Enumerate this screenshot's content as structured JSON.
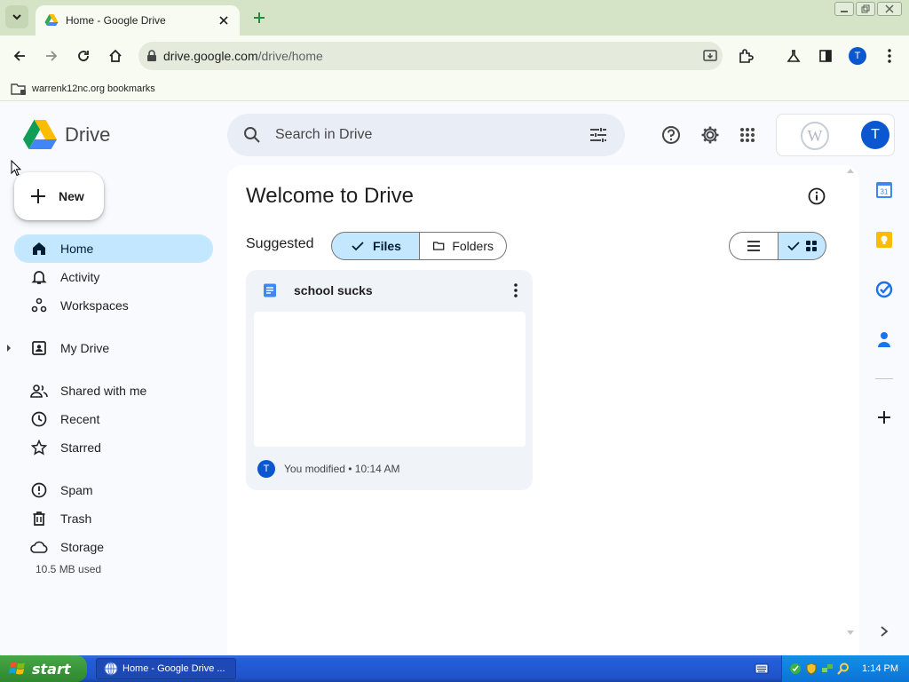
{
  "browser": {
    "tab_title": "Home - Google Drive",
    "url_domain": "drive.google.com",
    "url_path": "/drive/home",
    "profile_initial": "T",
    "bookmark_label": "warrenk12nc.org bookmarks",
    "theme_color": "#d5e3c7"
  },
  "drive": {
    "logo_text": "Drive",
    "search_placeholder": "Search in Drive",
    "new_label": "New",
    "account_initial": "T",
    "workspace_logo_letter": "W",
    "nav": [
      {
        "label": "Home",
        "icon": "home-icon",
        "active": true
      },
      {
        "label": "Activity",
        "icon": "bell-icon"
      },
      {
        "label": "Workspaces",
        "icon": "workspaces-icon"
      },
      {
        "label": "My Drive",
        "icon": "my-drive-icon"
      },
      {
        "label": "Shared with me",
        "icon": "people-icon"
      },
      {
        "label": "Recent",
        "icon": "clock-icon"
      },
      {
        "label": "Starred",
        "icon": "star-icon"
      },
      {
        "label": "Spam",
        "icon": "spam-icon"
      },
      {
        "label": "Trash",
        "icon": "trash-icon"
      },
      {
        "label": "Storage",
        "icon": "cloud-icon"
      }
    ],
    "storage_used": "10.5 MB used",
    "main": {
      "title": "Welcome to Drive",
      "suggested_label": "Suggested",
      "filter_files": "Files",
      "filter_folders": "Folders",
      "view_mode": "grid",
      "file_card": {
        "name": "school sucks",
        "type_icon": "docs-icon",
        "modifier_initial": "T",
        "modified_text": "You modified • 10:14 AM"
      }
    },
    "accent_color": "#c2e7ff"
  },
  "taskbar": {
    "start_label": "start",
    "task_item": "Home - Google Drive ...",
    "clock": "1:14 PM"
  }
}
